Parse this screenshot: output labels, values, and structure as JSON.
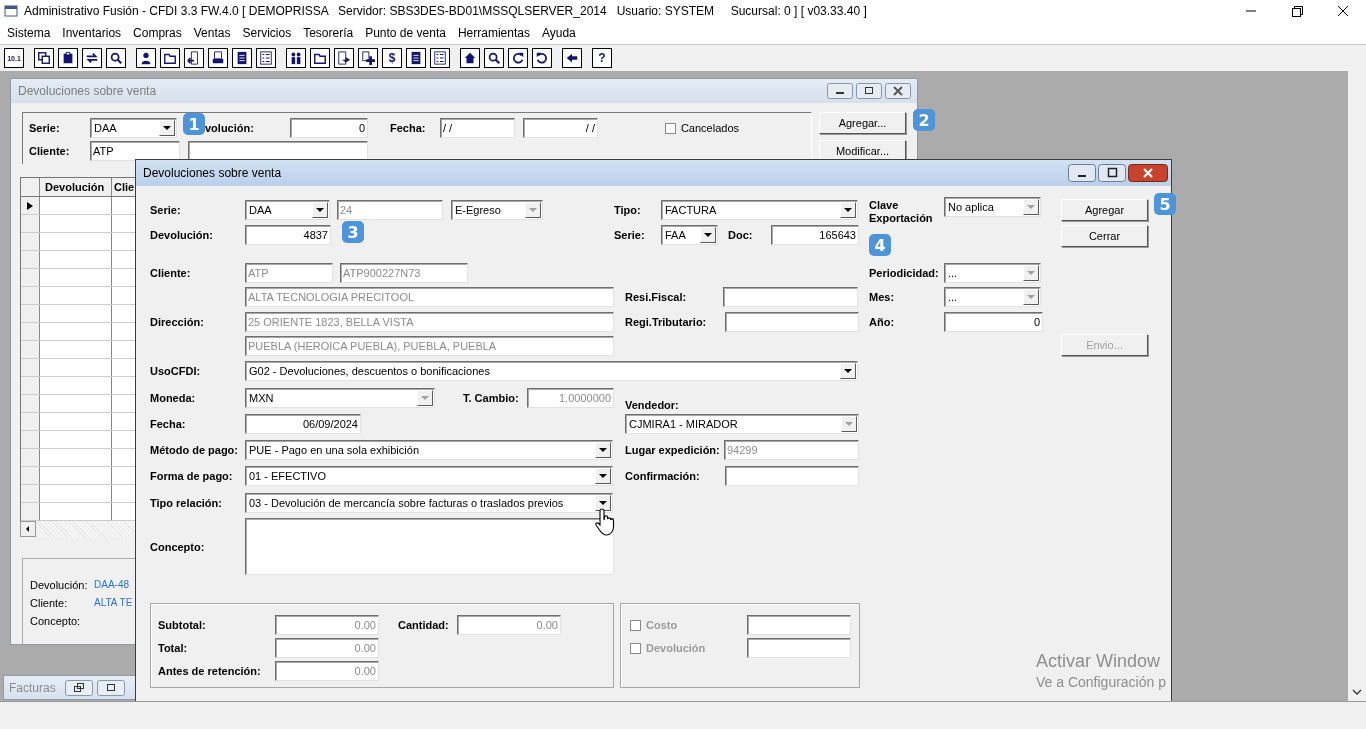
{
  "app": {
    "title": "Administrativo Fusión - CFDI 3.3 FW.4.0 [ DEMOPRISSA   Servidor: SBS3DES-BD01\\MSSQLSERVER_2014   Usuario: SYSTEM     Sucursal: 0 ] [ v03.33.40 ]"
  },
  "menu": [
    "Sistema",
    "Inventarios",
    "Compras",
    "Ventas",
    "Servicios",
    "Tesorería",
    "Punto de venta",
    "Herramientas",
    "Ayuda"
  ],
  "toolbar": [
    [
      {
        "kind": "calc",
        "label": "10.1"
      }
    ],
    [
      {
        "kind": "copy"
      },
      {
        "kind": "clipboard"
      },
      {
        "kind": "swap"
      },
      {
        "kind": "search"
      }
    ],
    [
      {
        "kind": "person"
      },
      {
        "kind": "folder"
      },
      {
        "kind": "doc-in"
      },
      {
        "kind": "doc-print"
      },
      {
        "kind": "doc"
      },
      {
        "kind": "list"
      }
    ],
    [
      {
        "kind": "people"
      },
      {
        "kind": "folder"
      },
      {
        "kind": "doc-arrow"
      },
      {
        "kind": "doc-plus"
      },
      {
        "kind": "money",
        "label": "$"
      },
      {
        "kind": "doc"
      },
      {
        "kind": "list"
      }
    ],
    [
      {
        "kind": "home"
      },
      {
        "kind": "search"
      },
      {
        "kind": "rotate"
      },
      {
        "kind": "undo"
      }
    ],
    [
      {
        "kind": "back"
      }
    ],
    [
      {
        "kind": "help",
        "label": "?"
      }
    ]
  ],
  "back_window": {
    "title": "Devoluciones sobre venta",
    "serie": {
      "label": "Serie:",
      "value": "DAA"
    },
    "devolucion": {
      "label": "volución:",
      "value": "0"
    },
    "fecha": {
      "label": "Fecha:",
      "from": "/ /",
      "to": "/ /"
    },
    "cancelados": {
      "label": "Cancelados",
      "checked": false
    },
    "cliente": {
      "label": "Cliente:",
      "value": "ATP"
    },
    "buttons": [
      "Agregar...",
      "Modificar..."
    ],
    "grid": {
      "columns": [
        "Devolución",
        "Clie"
      ],
      "rows": [
        {
          "selected": true
        },
        {
          "selected": false
        },
        {
          "selected": false
        },
        {
          "selected": false
        },
        {
          "selected": false
        },
        {
          "selected": false
        },
        {
          "selected": false
        },
        {
          "selected": false
        },
        {
          "selected": false
        },
        {
          "selected": false
        },
        {
          "selected": false
        },
        {
          "selected": false
        },
        {
          "selected": false
        },
        {
          "selected": false
        },
        {
          "selected": false
        },
        {
          "selected": false
        },
        {
          "selected": false
        },
        {
          "selected": false
        }
      ]
    },
    "info": [
      {
        "label": "Devolución:",
        "value": "DAA-48"
      },
      {
        "label": "Cliente:",
        "value": "ALTA TE"
      },
      {
        "label": "Concepto:"
      }
    ]
  },
  "minimized_window": {
    "title": "Facturas"
  },
  "dialog": {
    "title": "Devoluciones sobre venta",
    "serie": {
      "label": "Serie:",
      "value": "DAA"
    },
    "folio": {
      "value": "24",
      "disabled": true
    },
    "efecto": {
      "value": "E-Egreso",
      "disabled": true
    },
    "devolucion": {
      "label": "Devolución:",
      "value": "4837"
    },
    "cliente": {
      "label": "Cliente:",
      "code": "ATP",
      "rfc": "ATP900227N73",
      "name": "ALTA TECNOLOGIA PRECITOOL",
      "disabled": true
    },
    "direccion": {
      "label": "Dirección:",
      "line1": "25 ORIENTE 1823, BELLA VISTA",
      "line2": "PUEBLA (HEROICA PUEBLA), PUEBLA, PUEBLA",
      "disabled": true
    },
    "uso_cfdi": {
      "label": "UsoCFDI:",
      "value": "G02 - Devoluciones, descuentos o bonificaciones"
    },
    "moneda": {
      "label": "Moneda:",
      "value": "MXN",
      "disabled": true
    },
    "tipo_cambio": {
      "label": "T. Cambio:",
      "value": "1.0000000",
      "disabled": true
    },
    "fecha": {
      "label": "Fecha:",
      "value": "06/09/2024"
    },
    "metodo_pago": {
      "label": "Método de pago:",
      "value": "PUE - Pago en una sola exhibición"
    },
    "forma_pago": {
      "label": "Forma de pago:",
      "value": "01 - EFECTIVO"
    },
    "tipo_relacion": {
      "label": "Tipo relación:",
      "value": "03 - Devolución de mercancía sobre facturas o traslados previos"
    },
    "concepto": {
      "label": "Concepto:"
    },
    "tipo": {
      "label": "Tipo:",
      "value": "FACTURA"
    },
    "serie_doc": {
      "label": "Serie:",
      "value": "FAA"
    },
    "doc": {
      "label": "Doc:",
      "value": "165643"
    },
    "resi_fiscal": {
      "label": "Resi.Fiscal:"
    },
    "regi_tributario": {
      "label": "Regi.Tributario:"
    },
    "vendedor": {
      "label": "Vendedor:",
      "value": "CJMIRA1 - MIRADOR",
      "disabled": true
    },
    "lugar_expedicion": {
      "label": "Lugar expedición:",
      "value": "94299",
      "disabled": true
    },
    "confirmacion": {
      "label": "Confirmación:"
    },
    "clave_exportacion": {
      "label": "Clave Exportación",
      "value": "No aplica",
      "disabled": true
    },
    "periodicidad": {
      "label": "Periodicidad:",
      "value": "...",
      "disabled": true
    },
    "mes": {
      "label": "Mes:",
      "value": "...",
      "disabled": true
    },
    "anio": {
      "label": "Año:",
      "value": "0"
    },
    "buttons": [
      {
        "label": "Agregar",
        "disabled": false
      },
      {
        "label": "Cerrar",
        "disabled": false
      },
      {
        "label": "Envio...",
        "disabled": true
      }
    ],
    "totals": [
      {
        "label": "Subtotal:",
        "value": "0.00"
      },
      {
        "label": "Total:",
        "value": "0.00"
      },
      {
        "label": "Antes de retención:",
        "value": "0.00"
      }
    ],
    "cantidad": {
      "label": "Cantidad:",
      "value": "0.00"
    },
    "options": [
      {
        "label": "Costo",
        "checked": false,
        "disabled": true
      },
      {
        "label": "Devolución",
        "checked": false,
        "disabled": true
      }
    ]
  },
  "badges": [
    "1",
    "2",
    "3",
    "4",
    "5"
  ],
  "os_notice": {
    "title": "Activar Window",
    "subtitle": "Ve a Configuración p"
  }
}
